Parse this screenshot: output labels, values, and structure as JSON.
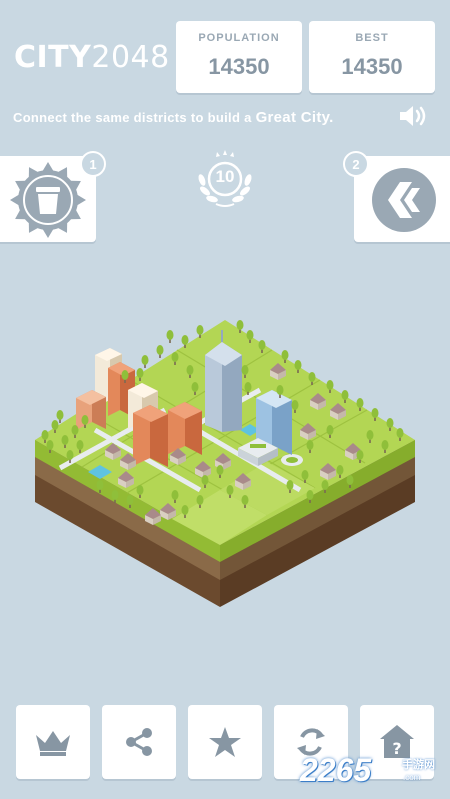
{
  "header": {
    "logo_city": "CITY",
    "logo_num": "2048",
    "population_label": "POPULATION",
    "population_value": "14350",
    "best_label": "BEST",
    "best_value": "14350"
  },
  "tagline": {
    "prefix": "Connect the same districts to build a ",
    "emphasis": "Great City."
  },
  "powerups": {
    "left_count": "1",
    "right_count": "2",
    "left_icon": "cup-badge-icon",
    "right_icon": "undo-chevron-icon"
  },
  "level": {
    "value": "10"
  },
  "toolbar": {
    "items": [
      {
        "icon": "crown-icon"
      },
      {
        "icon": "share-icon"
      },
      {
        "icon": "star-icon"
      },
      {
        "icon": "refresh-icon"
      },
      {
        "icon": "help-home-icon"
      }
    ]
  },
  "watermark": {
    "brand": "2265",
    "cn": "手游网",
    "url": ".com"
  },
  "colors": {
    "background": "#c9d8e2",
    "grass": "#a8cf45",
    "soil": "#6b4a2e",
    "icon_gray": "#8796a3"
  }
}
